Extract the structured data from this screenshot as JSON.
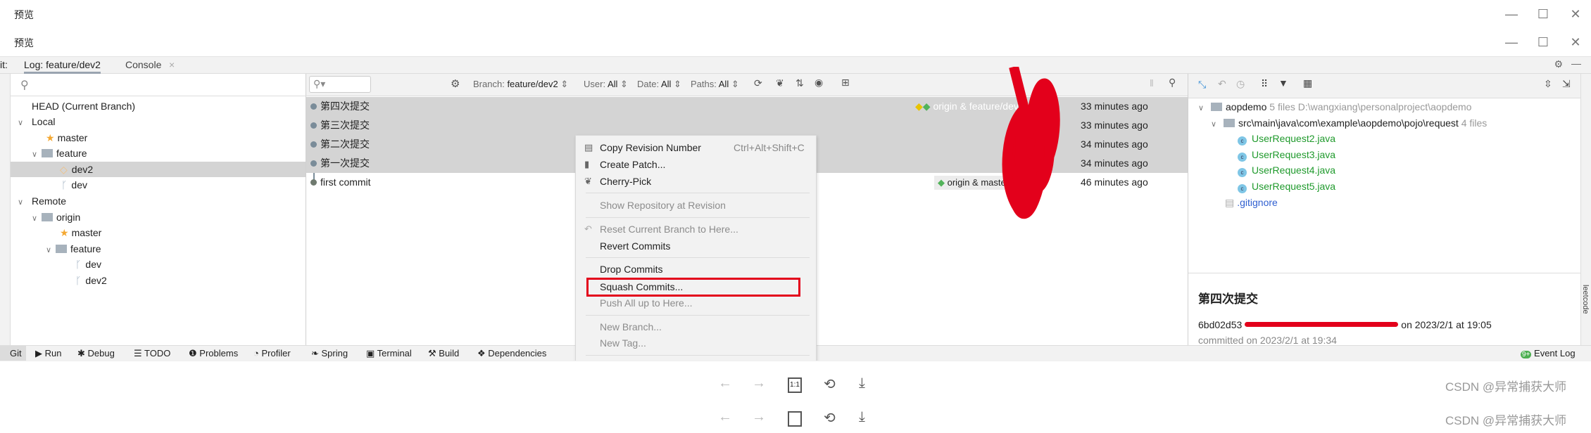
{
  "window": {
    "title_1": "预览",
    "title_2": "预览",
    "minimize": "—",
    "maximize": "☐",
    "close": "✕"
  },
  "ide": {
    "tabs": {
      "prefix": "it:",
      "log": "Log: feature/dev2",
      "console": "Console",
      "close": "×"
    },
    "branches": {
      "search_placeholder": "",
      "head": "HEAD (Current Branch)",
      "local": "Local",
      "local_master": "master",
      "local_feature": "feature",
      "local_dev2": "dev2",
      "local_dev": "dev",
      "remote": "Remote",
      "origin": "origin",
      "origin_master": "master",
      "origin_feature": "feature",
      "origin_dev": "dev",
      "origin_dev2": "dev2"
    },
    "log_toolbar": {
      "branch_label": "Branch:",
      "branch_value": "feature/dev2",
      "user_label": "User:",
      "user_value": "All",
      "date_label": "Date:",
      "date_value": "All",
      "paths_label": "Paths:",
      "paths_value": "All"
    },
    "commits": [
      {
        "message": "第四次提交",
        "refs": "origin & feature/dev2",
        "time": "33 minutes ago",
        "selected": true
      },
      {
        "message": "第三次提交",
        "refs": "",
        "time": "33 minutes ago",
        "selected": true
      },
      {
        "message": "第二次提交",
        "refs": "",
        "time": "34 minutes ago",
        "selected": true
      },
      {
        "message": "第一次提交",
        "refs": "",
        "time": "34 minutes ago",
        "selected": true
      },
      {
        "message": "first commit",
        "refs": "origin & master",
        "time": "46 minutes ago",
        "selected": false
      }
    ],
    "context_menu": {
      "copy_revision": "Copy Revision Number",
      "copy_shortcut": "Ctrl+Alt+Shift+C",
      "create_patch": "Create Patch...",
      "cherry_pick": "Cherry-Pick",
      "show_repo": "Show Repository at Revision",
      "reset": "Reset Current Branch to Here...",
      "revert": "Revert Commits",
      "drop": "Drop Commits",
      "squash": "Squash Commits...",
      "push": "Push All up to Here...",
      "new_branch": "New Branch...",
      "new_tag": "New Tag..."
    },
    "changes": {
      "root": "aopdemo",
      "root_count": "5 files",
      "root_path": "D:\\wangxiang\\personalproject\\aopdemo",
      "dir": "src\\main\\java\\com\\example\\aopdemo\\pojo\\request",
      "dir_count": "4 files",
      "files": [
        "UserRequest2.java",
        "UserRequest3.java",
        "UserRequest4.java",
        "UserRequest5.java"
      ],
      "other": ".gitignore"
    },
    "details": {
      "title": "第四次提交",
      "hash": "6bd02d53",
      "authored": "on 2023/2/1 at 19:05",
      "committed": "committed on 2023/2/1 at 19:34"
    },
    "bottom_tools": [
      "Git",
      "Run",
      "Debug",
      "TODO",
      "Problems",
      "Profiler",
      "Spring",
      "Terminal",
      "Build",
      "Dependencies"
    ],
    "event_log": "Event Log",
    "event_badge": "9+",
    "side_label": "leetcode"
  },
  "preview": {
    "zoom_label": "1:1",
    "watermark": "CSDN @异常捕获大师"
  },
  "colors": {
    "annotation": "#e3001b",
    "selection": "#d4d4d4",
    "added_file": "#1f9a2c"
  }
}
